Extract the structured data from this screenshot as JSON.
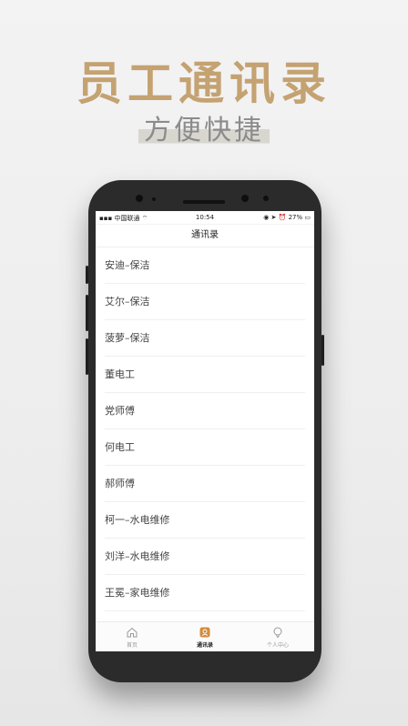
{
  "banner": {
    "title": "员工通讯录",
    "subtitle": "方便快捷"
  },
  "status_bar": {
    "carrier": "中国联通",
    "time": "10:54",
    "battery": "27%"
  },
  "nav": {
    "title": "通讯录"
  },
  "contacts": [
    {
      "name": "安迪–保洁"
    },
    {
      "name": "艾尔–保洁"
    },
    {
      "name": "菠萝–保洁"
    },
    {
      "name": "董电工"
    },
    {
      "name": "党师傅"
    },
    {
      "name": "何电工"
    },
    {
      "name": "郝师傅"
    },
    {
      "name": "柯一–水电维修"
    },
    {
      "name": "刘洋–水电维修"
    },
    {
      "name": "王冕–家电维修"
    }
  ],
  "tabbar": {
    "home": {
      "label": "首页",
      "icon": "home-icon"
    },
    "contacts": {
      "label": "通讯录",
      "icon": "contacts-icon"
    },
    "profile": {
      "label": "个人中心",
      "icon": "person-icon"
    }
  },
  "colors": {
    "accent": "#c4a271",
    "active_tab": "#d28b3c"
  }
}
